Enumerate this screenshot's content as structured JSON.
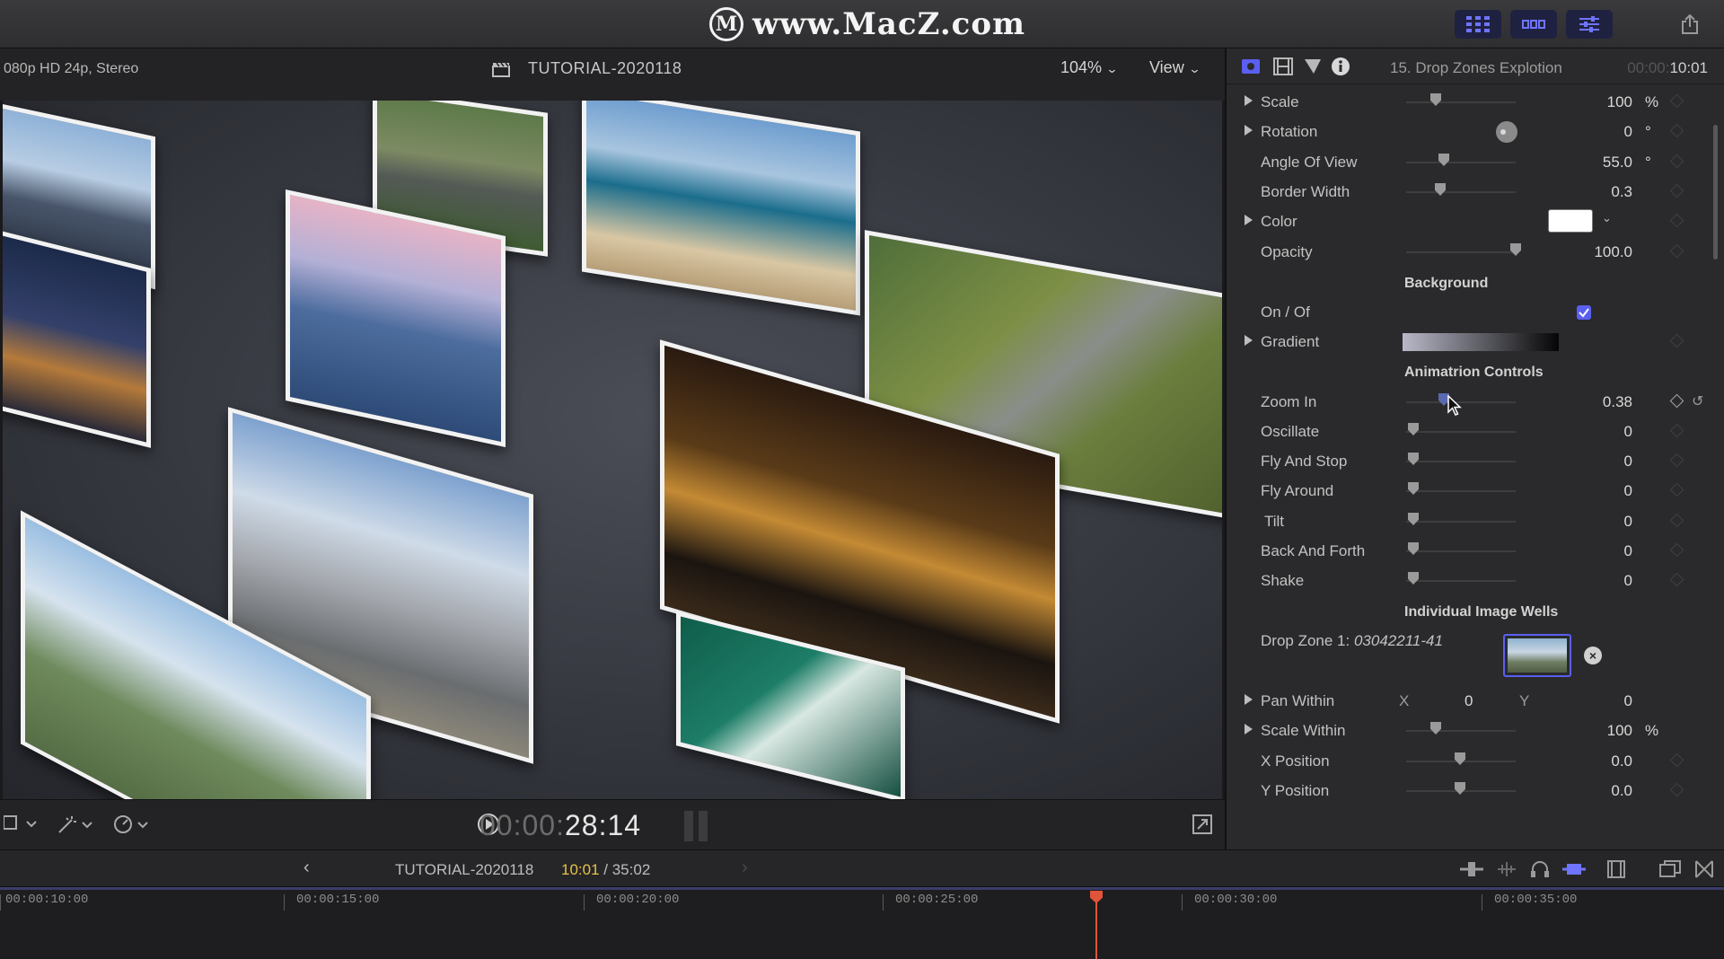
{
  "watermark": {
    "logo": "M",
    "text": "www.MacZ.com"
  },
  "titlebar": {
    "buttons": [
      {
        "icon": "browser-grid-icon",
        "active": true
      },
      {
        "icon": "timeline-icon",
        "active": true
      },
      {
        "icon": "inspector-sliders-icon",
        "active": true
      },
      {
        "icon": "share-icon",
        "active": false
      }
    ]
  },
  "viewer": {
    "format": "080p HD 24p, Stereo",
    "project": "TUTORIAL-2020118",
    "zoom": "104%",
    "view": "View",
    "timecode_dim": "00:00:",
    "timecode": "28:14"
  },
  "inspector": {
    "title": "15. Drop Zones Explotion",
    "duration_dim": "00:00:",
    "duration": "10:01",
    "rows": [
      {
        "label": "Scale",
        "value": "100",
        "unit": "%",
        "expand": true,
        "slider": 0.22
      },
      {
        "label": "Rotation",
        "value": "0",
        "unit": "°",
        "expand": true,
        "dial": true
      },
      {
        "label": "Angle Of View",
        "value": "55.0",
        "unit": "°",
        "expand": false,
        "slider": 0.27
      },
      {
        "label": "Border Width",
        "value": "0.3",
        "unit": "",
        "expand": false,
        "slider": 0.24
      },
      {
        "label": "Color",
        "value": "",
        "unit": "",
        "expand": true,
        "swatch": "#ffffff"
      },
      {
        "label": "Opacity",
        "value": "100.0",
        "unit": "",
        "expand": false,
        "slider": 0.82
      }
    ],
    "background_heading": "Background",
    "onoff_label": "On / Of",
    "onoff_checked": true,
    "gradient_label": "Gradient",
    "animation_heading": "Animatrion Controls",
    "animation_rows": [
      {
        "label": "Zoom In",
        "value": "0.38",
        "slider": 0.27
      },
      {
        "label": "Oscillate",
        "value": "0",
        "slider": 0.0
      },
      {
        "label": "Fly And Stop",
        "value": "0",
        "slider": 0.0
      },
      {
        "label": "Fly Around",
        "value": "0",
        "slider": 0.0
      },
      {
        "label": "Tilt",
        "value": "0",
        "slider": 0.0
      },
      {
        "label": "Back And Forth",
        "value": "0",
        "slider": 0.0
      },
      {
        "label": "Shake",
        "value": "0",
        "slider": 0.0
      }
    ],
    "wells_heading": "Individual Image Wells",
    "dropzone_label": "Drop Zone 1:",
    "dropzone_file": "03042211-41",
    "pan_within": {
      "label": "Pan Within",
      "x_label": "X",
      "x": "0",
      "y_label": "Y",
      "y": "0"
    },
    "scale_within": {
      "label": "Scale Within",
      "value": "100",
      "unit": "%",
      "slider": 0.22
    },
    "x_position": {
      "label": "X Position",
      "value": "0.0",
      "slider": 0.43
    },
    "y_position": {
      "label": "Y Position",
      "value": "0.0",
      "slider": 0.43
    }
  },
  "timeline": {
    "project": "TUTORIAL-2020118",
    "current": "10:01",
    "total": "/ 35:02",
    "ticks": [
      "00:00:10:00",
      "00:00:15:00",
      "00:00:20:00",
      "00:00:25:00",
      "00:00:30:00",
      "00:00:35:00"
    ],
    "playhead_color": "#e0553a"
  }
}
